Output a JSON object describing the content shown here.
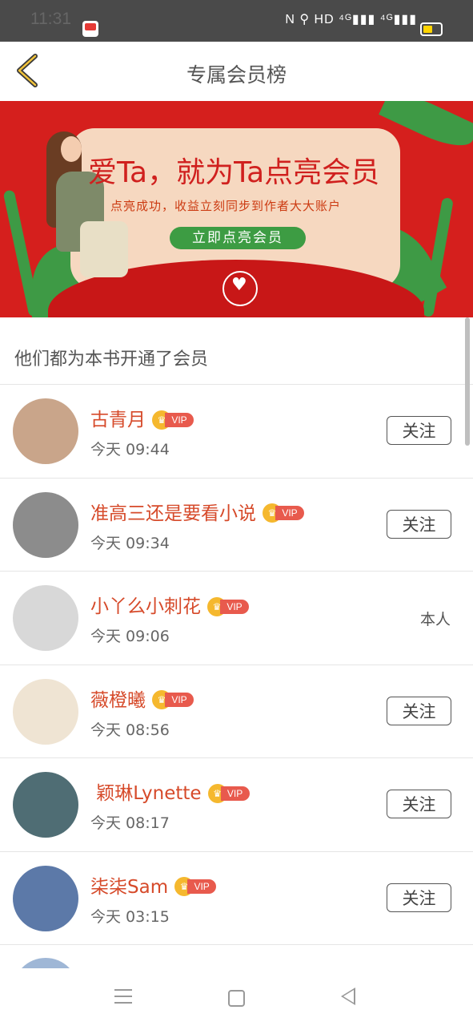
{
  "status_bar": {
    "time": "11:31",
    "indicators": "N  ⚲ HD ⁴ᴳ▮▮▮ ⁴ᴳ▮▮▮"
  },
  "header": {
    "title": "专属会员榜"
  },
  "banner": {
    "headline": "爱Ta，就为Ta点亮会员",
    "subtitle": "点亮成功，收益立刻同步到作者大大账户",
    "cta": "立即点亮会员"
  },
  "section_title": "他们都为本书开通了会员",
  "vip_label": "VIP",
  "follow_label": "关注",
  "members": [
    {
      "name": "古青月",
      "time": "今天 09:44",
      "action": "follow",
      "avatar_color": "#c9a58a"
    },
    {
      "name": "准高三还是要看小说",
      "time": "今天 09:34",
      "action": "follow",
      "avatar_color": "#8c8c8c"
    },
    {
      "name": "小丫么小刺花",
      "time": "今天 09:06",
      "action": "self",
      "action_text": "本人",
      "avatar_color": "#d8d8d8"
    },
    {
      "name": "薇橙曦",
      "time": "今天 08:56",
      "action": "follow",
      "avatar_color": "#efe4d3"
    },
    {
      "name": "⁡ 颖琳Lynette",
      "time": "今天 08:17",
      "action": "follow",
      "avatar_color": "#4f6d74"
    },
    {
      "name": "柒柒Sam",
      "time": "今天 03:15",
      "action": "follow",
      "avatar_color": "#5c79a8"
    }
  ],
  "colors": {
    "accent_red": "#d51f1d",
    "name_color": "#d64a2a",
    "cta_green": "#3d9c43"
  }
}
